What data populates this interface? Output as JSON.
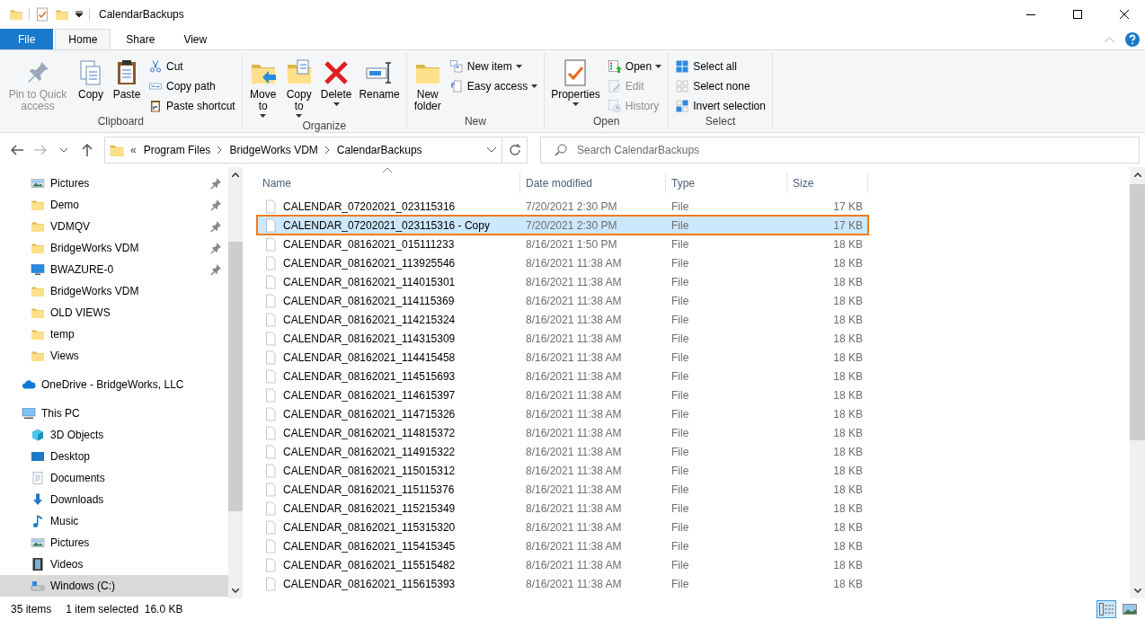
{
  "window": {
    "title": "CalendarBackups"
  },
  "ribbon_tabs": [
    {
      "label": "File",
      "kind": "file",
      "selected": false
    },
    {
      "label": "Home",
      "kind": "tab",
      "selected": true
    },
    {
      "label": "Share",
      "kind": "tab",
      "selected": false
    },
    {
      "label": "View",
      "kind": "tab",
      "selected": false
    }
  ],
  "ribbon_groups": [
    {
      "label": "Clipboard",
      "items": [
        {
          "kind": "large",
          "label": "Pin to Quick access",
          "disabled": true,
          "dropdown": false
        },
        {
          "kind": "large",
          "label": "Copy",
          "disabled": false,
          "dropdown": false
        },
        {
          "kind": "large",
          "label": "Paste",
          "disabled": false,
          "dropdown": false
        },
        {
          "kind": "stack",
          "items": [
            {
              "label": "Cut",
              "disabled": false,
              "dropdown": false
            },
            {
              "label": "Copy path",
              "disabled": false,
              "dropdown": false
            },
            {
              "label": "Paste shortcut",
              "disabled": false,
              "dropdown": false
            }
          ]
        }
      ]
    },
    {
      "label": "Organize",
      "items": [
        {
          "kind": "large",
          "label": "Move to",
          "disabled": false,
          "dropdown": true
        },
        {
          "kind": "large",
          "label": "Copy to",
          "disabled": false,
          "dropdown": true
        },
        {
          "kind": "large",
          "label": "Delete",
          "disabled": false,
          "dropdown": true
        },
        {
          "kind": "large",
          "label": "Rename",
          "disabled": false,
          "dropdown": false
        }
      ]
    },
    {
      "label": "New",
      "items": [
        {
          "kind": "large",
          "label": "New folder",
          "disabled": false,
          "dropdown": false
        },
        {
          "kind": "stack",
          "items": [
            {
              "label": "New item",
              "disabled": false,
              "dropdown": true
            },
            {
              "label": "Easy access",
              "disabled": false,
              "dropdown": true
            }
          ]
        }
      ]
    },
    {
      "label": "Open",
      "items": [
        {
          "kind": "large",
          "label": "Properties",
          "disabled": false,
          "dropdown": true
        },
        {
          "kind": "stack",
          "items": [
            {
              "label": "Open",
              "disabled": false,
              "dropdown": true
            },
            {
              "label": "Edit",
              "disabled": true,
              "dropdown": false
            },
            {
              "label": "History",
              "disabled": true,
              "dropdown": false
            }
          ]
        }
      ]
    },
    {
      "label": "Select",
      "items": [
        {
          "kind": "stack",
          "items": [
            {
              "label": "Select all",
              "disabled": false,
              "dropdown": false
            },
            {
              "label": "Select none",
              "disabled": false,
              "dropdown": false
            },
            {
              "label": "Invert selection",
              "disabled": false,
              "dropdown": false
            }
          ]
        }
      ]
    }
  ],
  "address": {
    "overflow": "«",
    "crumbs": [
      "Program Files",
      "BridgeWorks VDM",
      "CalendarBackups"
    ]
  },
  "search": {
    "placeholder": "Search CalendarBackups"
  },
  "sidebar": {
    "pinned_folders": [
      {
        "label": "Pictures",
        "pinned": true,
        "selected": false
      },
      {
        "label": "Demo",
        "pinned": true,
        "selected": false
      },
      {
        "label": "VDMQV",
        "pinned": true,
        "selected": false
      },
      {
        "label": "BridgeWorks VDM",
        "pinned": true,
        "selected": false
      },
      {
        "label": "BWAZURE-0",
        "pinned": true,
        "selected": false
      },
      {
        "label": "BridgeWorks VDM",
        "pinned": false,
        "selected": false
      },
      {
        "label": "OLD VIEWS",
        "pinned": false,
        "selected": false
      },
      {
        "label": "temp",
        "pinned": false,
        "selected": false
      },
      {
        "label": "Views",
        "pinned": false,
        "selected": false
      }
    ],
    "onedrive": {
      "label": "OneDrive - BridgeWorks, LLC",
      "selected": false
    },
    "this_pc": {
      "label": "This PC",
      "selected": false,
      "children": [
        {
          "label": "3D Objects",
          "selected": false
        },
        {
          "label": "Desktop",
          "selected": false
        },
        {
          "label": "Documents",
          "selected": false
        },
        {
          "label": "Downloads",
          "selected": false
        },
        {
          "label": "Music",
          "selected": false
        },
        {
          "label": "Pictures",
          "selected": false
        },
        {
          "label": "Videos",
          "selected": false
        },
        {
          "label": "Windows (C:)",
          "selected": true
        }
      ]
    }
  },
  "table": {
    "columns": [
      "Name",
      "Date modified",
      "Type",
      "Size"
    ],
    "rows": [
      {
        "name": "CALENDAR_07202021_023115316",
        "date": "7/20/2021 2:30 PM",
        "type": "File",
        "size": "17 KB",
        "selected": false,
        "outlined": false
      },
      {
        "name": "CALENDAR_07202021_023115316 - Copy",
        "date": "7/20/2021 2:30 PM",
        "type": "File",
        "size": "17 KB",
        "selected": true,
        "outlined": true
      },
      {
        "name": "CALENDAR_08162021_015111233",
        "date": "8/16/2021 1:50 PM",
        "type": "File",
        "size": "18 KB",
        "selected": false,
        "outlined": false
      },
      {
        "name": "CALENDAR_08162021_113925546",
        "date": "8/16/2021 11:38 AM",
        "type": "File",
        "size": "18 KB",
        "selected": false,
        "outlined": false
      },
      {
        "name": "CALENDAR_08162021_114015301",
        "date": "8/16/2021 11:38 AM",
        "type": "File",
        "size": "18 KB",
        "selected": false,
        "outlined": false
      },
      {
        "name": "CALENDAR_08162021_114115369",
        "date": "8/16/2021 11:38 AM",
        "type": "File",
        "size": "18 KB",
        "selected": false,
        "outlined": false
      },
      {
        "name": "CALENDAR_08162021_114215324",
        "date": "8/16/2021 11:38 AM",
        "type": "File",
        "size": "18 KB",
        "selected": false,
        "outlined": false
      },
      {
        "name": "CALENDAR_08162021_114315309",
        "date": "8/16/2021 11:38 AM",
        "type": "File",
        "size": "18 KB",
        "selected": false,
        "outlined": false
      },
      {
        "name": "CALENDAR_08162021_114415458",
        "date": "8/16/2021 11:38 AM",
        "type": "File",
        "size": "18 KB",
        "selected": false,
        "outlined": false
      },
      {
        "name": "CALENDAR_08162021_114515693",
        "date": "8/16/2021 11:38 AM",
        "type": "File",
        "size": "18 KB",
        "selected": false,
        "outlined": false
      },
      {
        "name": "CALENDAR_08162021_114615397",
        "date": "8/16/2021 11:38 AM",
        "type": "File",
        "size": "18 KB",
        "selected": false,
        "outlined": false
      },
      {
        "name": "CALENDAR_08162021_114715326",
        "date": "8/16/2021 11:38 AM",
        "type": "File",
        "size": "18 KB",
        "selected": false,
        "outlined": false
      },
      {
        "name": "CALENDAR_08162021_114815372",
        "date": "8/16/2021 11:38 AM",
        "type": "File",
        "size": "18 KB",
        "selected": false,
        "outlined": false
      },
      {
        "name": "CALENDAR_08162021_114915322",
        "date": "8/16/2021 11:38 AM",
        "type": "File",
        "size": "18 KB",
        "selected": false,
        "outlined": false
      },
      {
        "name": "CALENDAR_08162021_115015312",
        "date": "8/16/2021 11:38 AM",
        "type": "File",
        "size": "18 KB",
        "selected": false,
        "outlined": false
      },
      {
        "name": "CALENDAR_08162021_115115376",
        "date": "8/16/2021 11:38 AM",
        "type": "File",
        "size": "18 KB",
        "selected": false,
        "outlined": false
      },
      {
        "name": "CALENDAR_08162021_115215349",
        "date": "8/16/2021 11:38 AM",
        "type": "File",
        "size": "18 KB",
        "selected": false,
        "outlined": false
      },
      {
        "name": "CALENDAR_08162021_115315320",
        "date": "8/16/2021 11:38 AM",
        "type": "File",
        "size": "18 KB",
        "selected": false,
        "outlined": false
      },
      {
        "name": "CALENDAR_08162021_115415345",
        "date": "8/16/2021 11:38 AM",
        "type": "File",
        "size": "18 KB",
        "selected": false,
        "outlined": false
      },
      {
        "name": "CALENDAR_08162021_115515482",
        "date": "8/16/2021 11:38 AM",
        "type": "File",
        "size": "18 KB",
        "selected": false,
        "outlined": false
      },
      {
        "name": "CALENDAR_08162021_115615393",
        "date": "8/16/2021 11:38 AM",
        "type": "File",
        "size": "18 KB",
        "selected": false,
        "outlined": false
      }
    ]
  },
  "status_bar": {
    "count": "35 items",
    "selection": "1 item selected  16.0 KB"
  },
  "view_buttons": [
    {
      "kind": "details",
      "selected": true
    },
    {
      "kind": "thumbnails",
      "selected": false
    }
  ]
}
